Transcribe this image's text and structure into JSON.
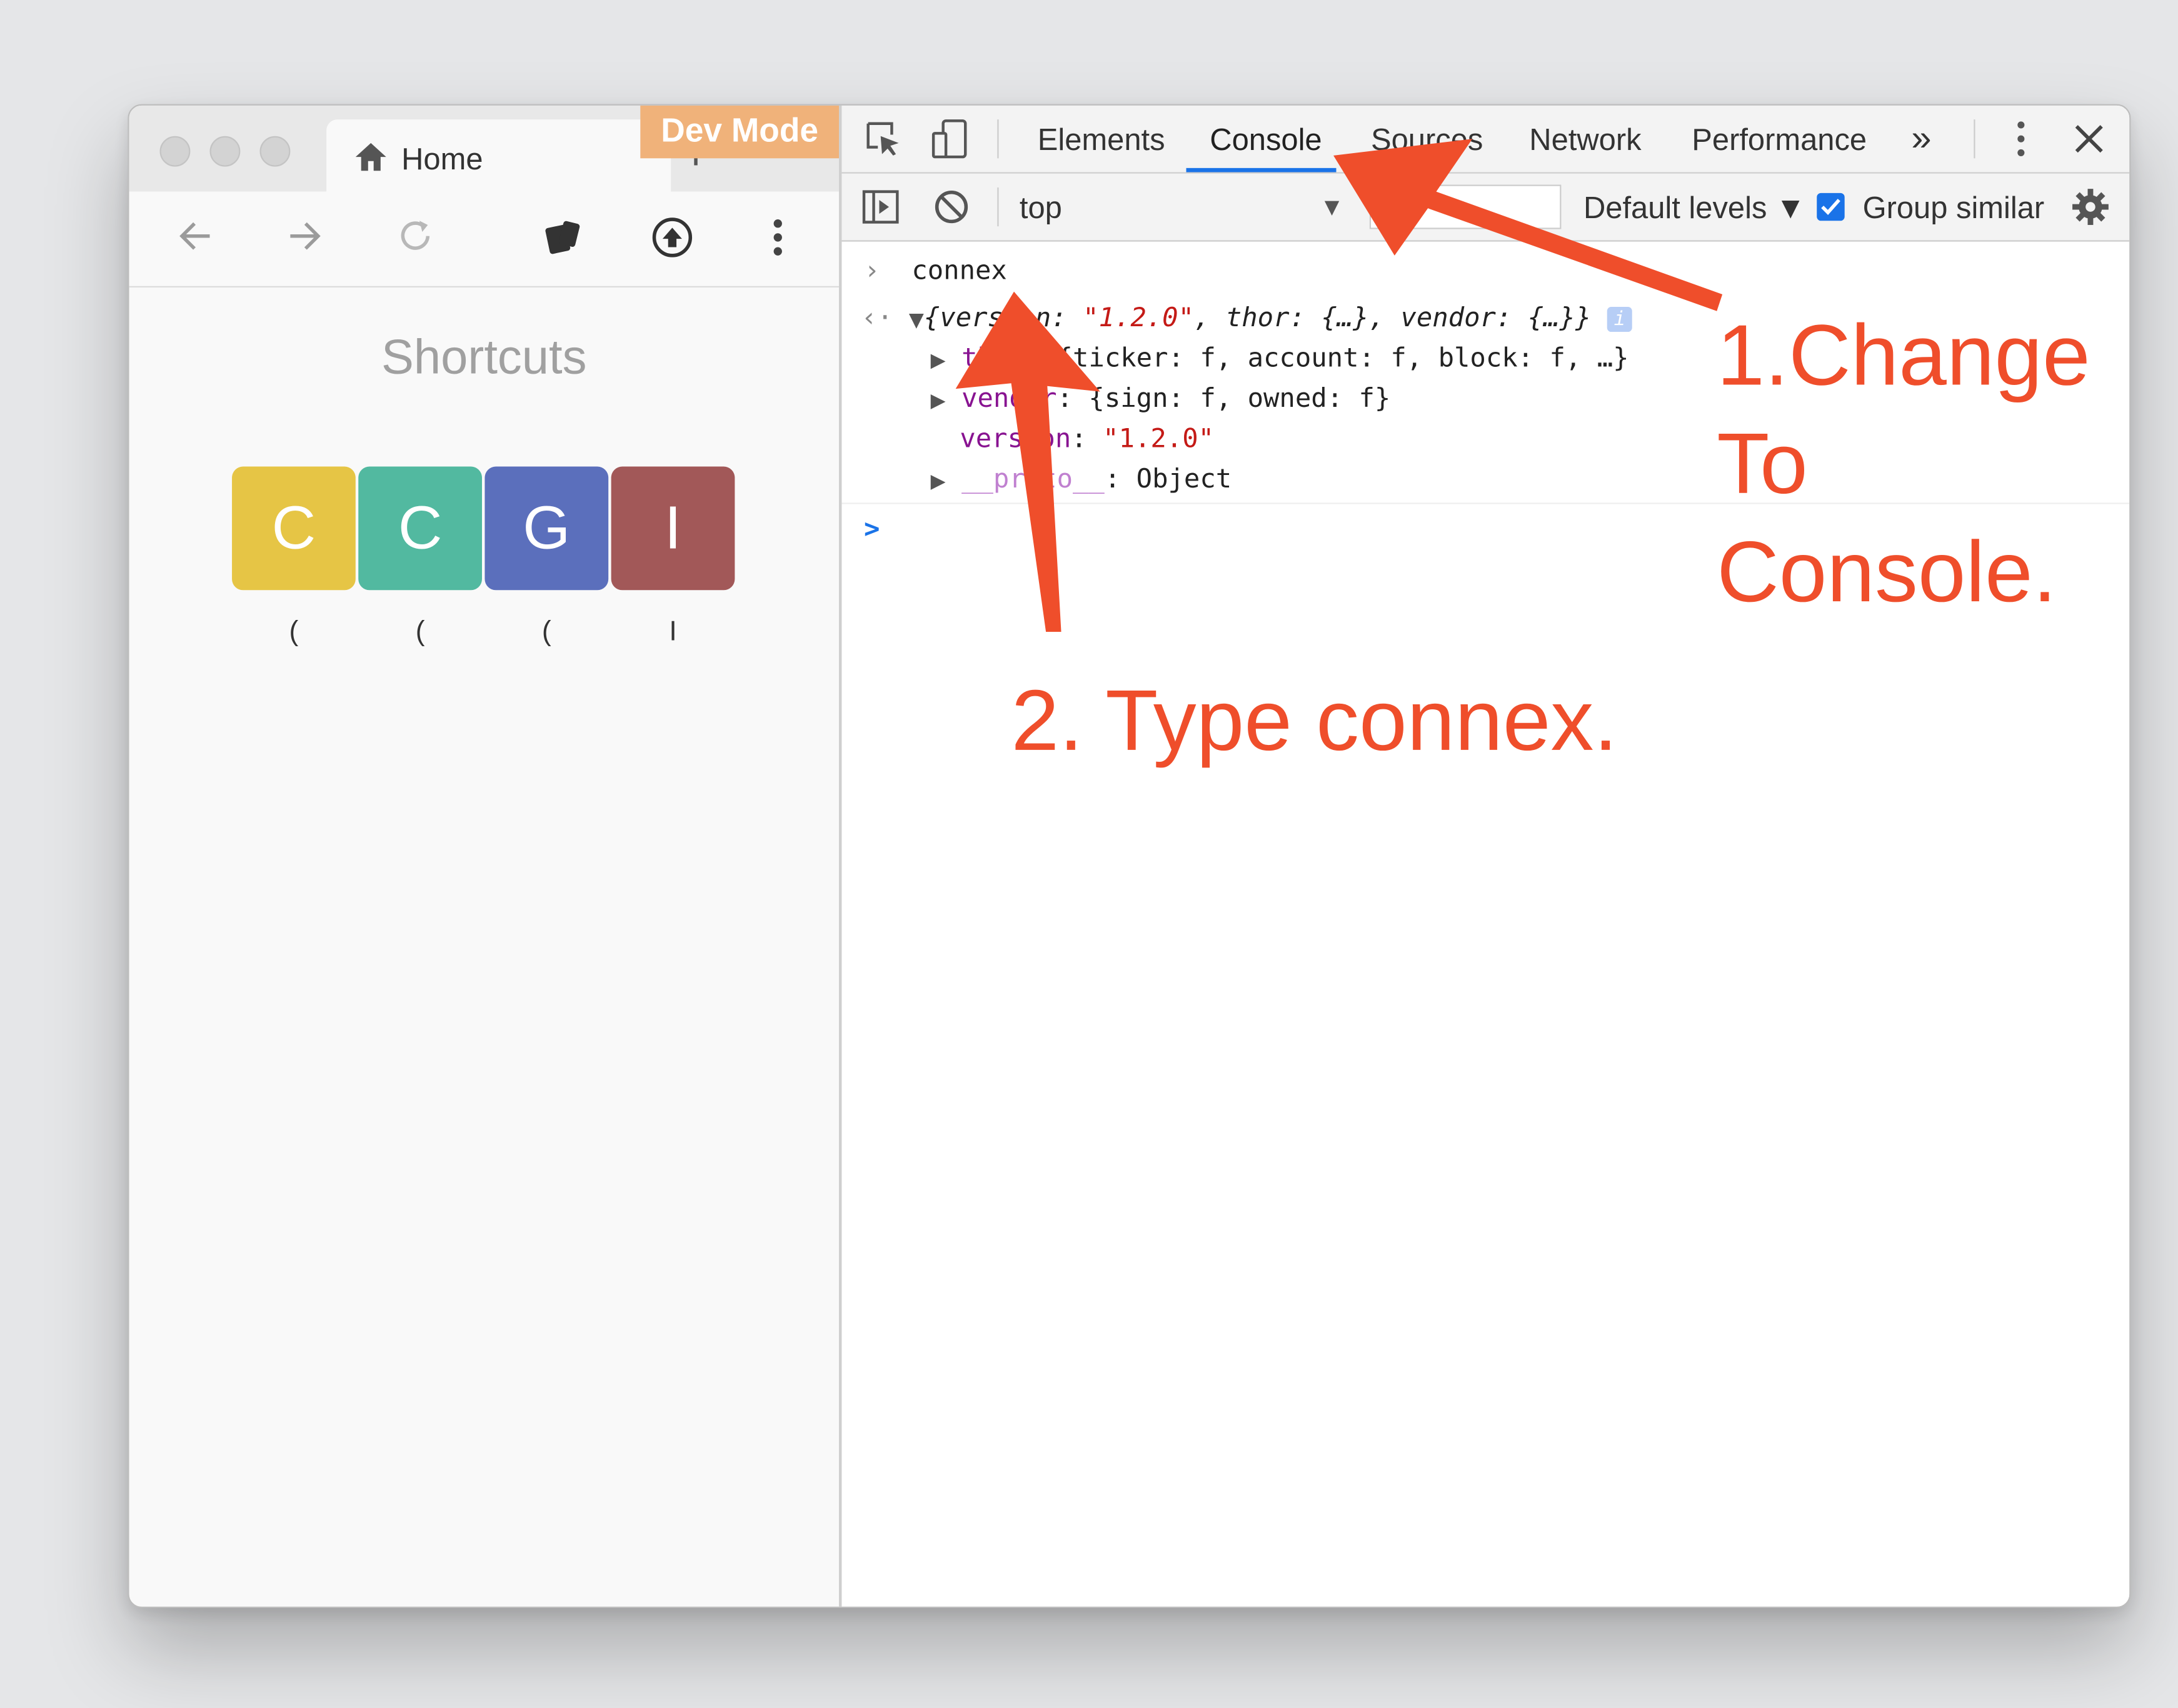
{
  "browser": {
    "tab_title": "Home",
    "new_tab_symbol": "+",
    "dev_mode_badge": "Dev Mode",
    "page_heading": "Shortcuts",
    "tiles": [
      {
        "letter": "C",
        "caption": "(",
        "color": "#e6c545"
      },
      {
        "letter": "C",
        "caption": "(",
        "color": "#52b9a0"
      },
      {
        "letter": "G",
        "caption": "(",
        "color": "#5b6fbc"
      },
      {
        "letter": "I",
        "caption": "I",
        "color": "#a25858"
      }
    ]
  },
  "devtools": {
    "tabs": [
      "Elements",
      "Console",
      "Sources",
      "Network",
      "Performance"
    ],
    "active_tab": "Console",
    "more_tabs": "»",
    "context": "top",
    "levels": "Default levels ▼",
    "group_similar": "Group similar",
    "group_similar_checked": true
  },
  "console": {
    "input": "connex",
    "summary": {
      "open": "{",
      "k1": "version",
      "v1": "\"1.2.0\"",
      "rest": ", thor: {…}, vendor: {…}}"
    },
    "props": [
      {
        "key": "thor",
        "value": ": {ticker: f, account: f, block: f, …}"
      },
      {
        "key": "vendor",
        "value": ": {sign: f, owned: f}"
      },
      {
        "key": "version",
        "value": "\"1.2.0\""
      },
      {
        "key": "__proto__",
        "value": ": Object"
      }
    ],
    "info_badge": "i",
    "prompt": ">"
  },
  "annotations": {
    "step1_lines": [
      "1.Change",
      "To",
      "Console."
    ],
    "step2": "2. Type connex.",
    "color": "#ef4e2b"
  }
}
